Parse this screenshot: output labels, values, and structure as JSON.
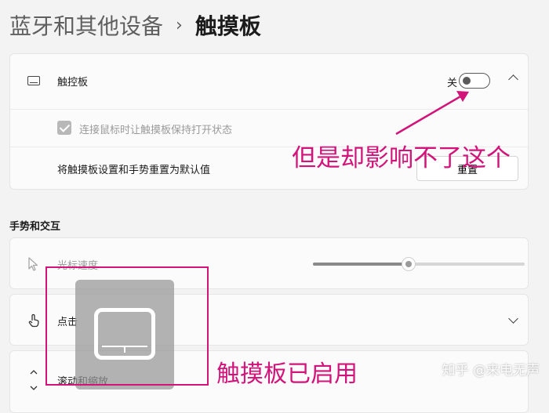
{
  "breadcrumb": {
    "parent": "蓝牙和其他设备",
    "separator": "›",
    "current": "触摸板"
  },
  "touchpad_card": {
    "icon": "touchpad-icon",
    "label": "触控板",
    "toggle_state_label": "关",
    "toggle_on": false,
    "checkbox_label": "连接鼠标时让触摸板保持打开状态",
    "checkbox_checked": true,
    "checkbox_disabled": true,
    "reset_label": "将触摸板设置和手势重置为默认值",
    "reset_button": "重置"
  },
  "section": {
    "title": "手势和交互"
  },
  "settings": [
    {
      "icon": "cursor-icon",
      "label": "光标速度",
      "slider_value_percent": 45,
      "disabled": true
    },
    {
      "icon": "tap-gesture-icon",
      "label": "点击"
    },
    {
      "icon": "scroll-arrows-icon",
      "label": "滚动和缩放"
    }
  ],
  "overlay": {
    "icon": "touchpad-enabled-icon"
  },
  "annotations": {
    "arrow_text": "但是却影响不了这个",
    "box_text": "触摸板已启用",
    "color": "#d2137a"
  },
  "watermark": "知乎 @来电无声",
  "colors": {
    "background": "#f3f3f3",
    "card": "#fbfbfb",
    "annotation": "#d2137a"
  }
}
